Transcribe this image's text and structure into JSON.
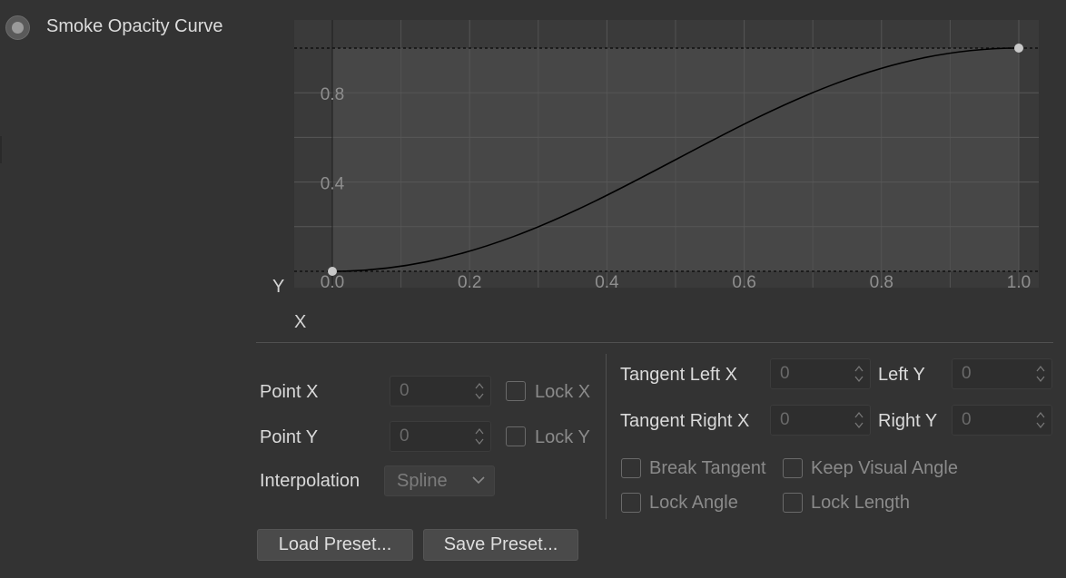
{
  "header": {
    "title": "Smoke Opacity Curve"
  },
  "graph": {
    "y_axis_letter": "Y",
    "x_axis_letter": "X",
    "x_ticks": [
      "0.0",
      "0.2",
      "0.4",
      "0.6",
      "0.8",
      "1.0"
    ],
    "y_ticks": [
      "0.8",
      "0.4"
    ],
    "curve_points": [
      {
        "x": 0.0,
        "y": 0.0
      },
      {
        "x": 1.0,
        "y": 1.0
      }
    ],
    "curve_color": "#000000",
    "point_color": "#c8c8c8"
  },
  "point": {
    "x_label": "Point X",
    "x_value": "0",
    "lock_x_label": "Lock X",
    "y_label": "Point Y",
    "y_value": "0",
    "lock_y_label": "Lock Y"
  },
  "interpolation": {
    "label": "Interpolation",
    "value": "Spline"
  },
  "tangent": {
    "left_x_label": "Tangent Left X",
    "left_x_value": "0",
    "left_y_label": "Left Y",
    "left_y_value": "0",
    "right_x_label": "Tangent Right X",
    "right_x_value": "0",
    "right_y_label": "Right Y",
    "right_y_value": "0",
    "break_tangent_label": "Break Tangent",
    "keep_visual_angle_label": "Keep Visual Angle",
    "lock_angle_label": "Lock Angle",
    "lock_length_label": "Lock Length"
  },
  "buttons": {
    "load_label": "Load Preset...",
    "save_label": "Save Preset..."
  }
}
